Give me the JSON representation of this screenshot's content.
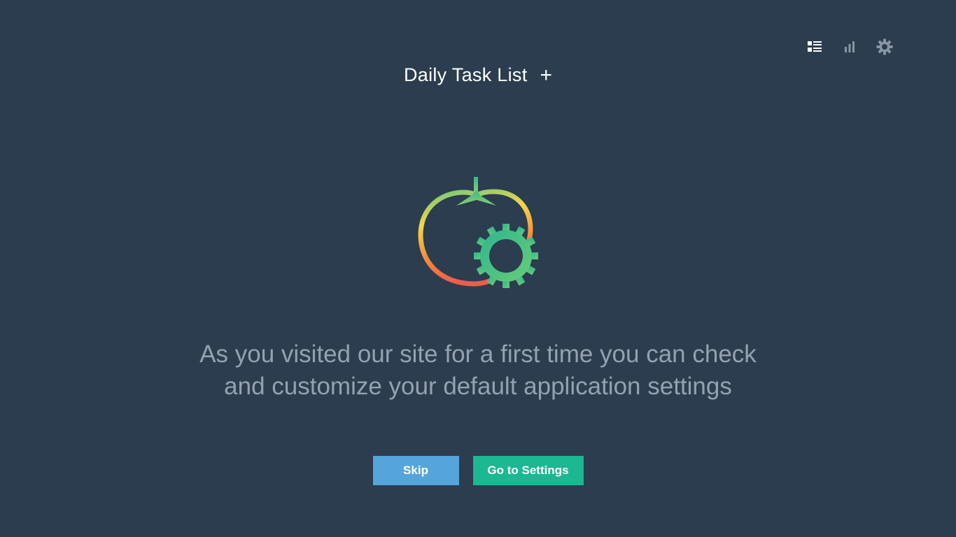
{
  "header": {
    "title": "Daily Task List",
    "add_label": "+"
  },
  "toolbar": {
    "icons": [
      "task-list-icon",
      "statistics-icon",
      "settings-icon"
    ]
  },
  "illustration": {
    "icon": "tomato-gear-icon",
    "gradient_colors": [
      "#73c87c",
      "#f5d44a",
      "#f47c3c",
      "#f05a4a"
    ],
    "gear_colors": [
      "#3cba8c",
      "#5fc97a"
    ]
  },
  "message": {
    "line1": "As you visited our site for a first time you can check",
    "line2": "and customize your default application settings"
  },
  "actions": {
    "skip_label": "Skip",
    "settings_label": "Go to Settings"
  },
  "colors": {
    "background": "#2b3d4f",
    "skip_button": "#55a5db",
    "settings_button": "#1bb892",
    "message_text": "#93a2b2"
  }
}
